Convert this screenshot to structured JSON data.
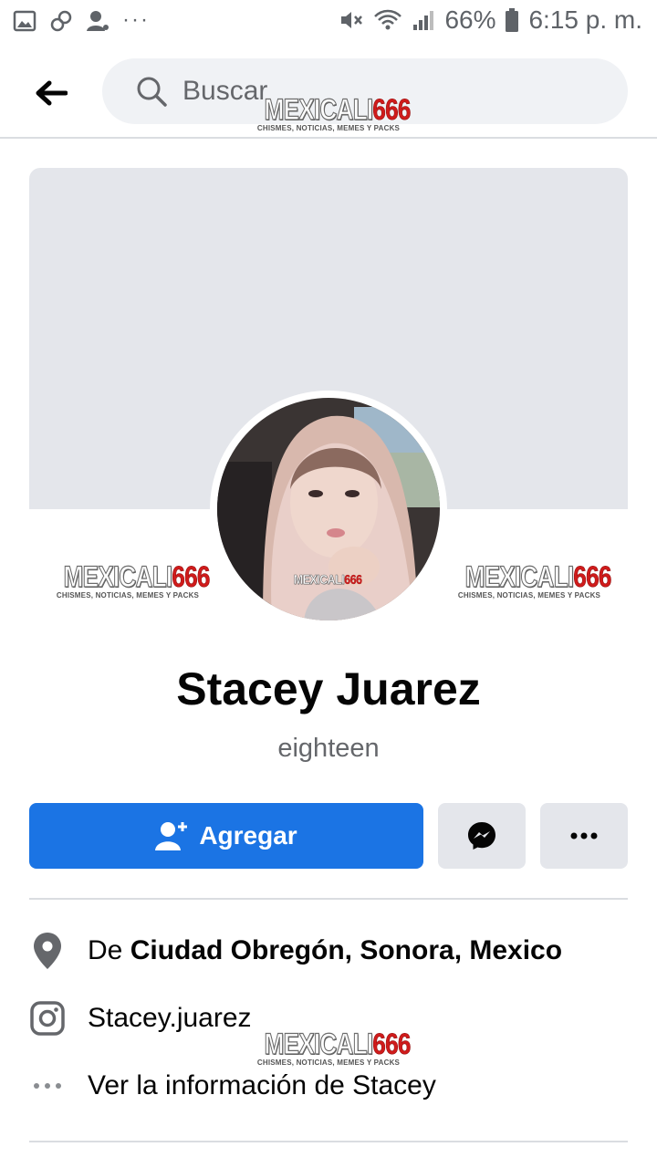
{
  "status_bar": {
    "battery": "66%",
    "time": "6:15 p. m.",
    "icons": [
      "image-icon",
      "link-icon",
      "person-sync-icon",
      "more-dots-icon",
      "mute-icon",
      "wifi-icon",
      "signal-icon",
      "battery-icon"
    ]
  },
  "header": {
    "back_icon": "arrow-left-icon",
    "search_placeholder": "Buscar"
  },
  "watermark": {
    "brand_part1": "MEXICALI",
    "brand_part2": "666",
    "tagline": "CHISMES, NOTICIAS, MEMES Y PACKS"
  },
  "profile": {
    "name": "Stacey Juarez",
    "bio": "eighteen"
  },
  "actions": {
    "add_label": "Agregar",
    "add_icon": "add-friend-icon",
    "message_icon": "messenger-icon",
    "more_icon": "more-horizontal-icon"
  },
  "info": {
    "location_prefix": "De ",
    "location_value": "Ciudad Obregón, Sonora, Mexico",
    "instagram": "Stacey.juarez",
    "see_about": "Ver la información de Stacey"
  },
  "colors": {
    "primary_blue": "#1b74e4",
    "cover_gray": "#e4e6eb",
    "secondary_text": "#65676b",
    "watermark_red": "#d01b1b"
  }
}
